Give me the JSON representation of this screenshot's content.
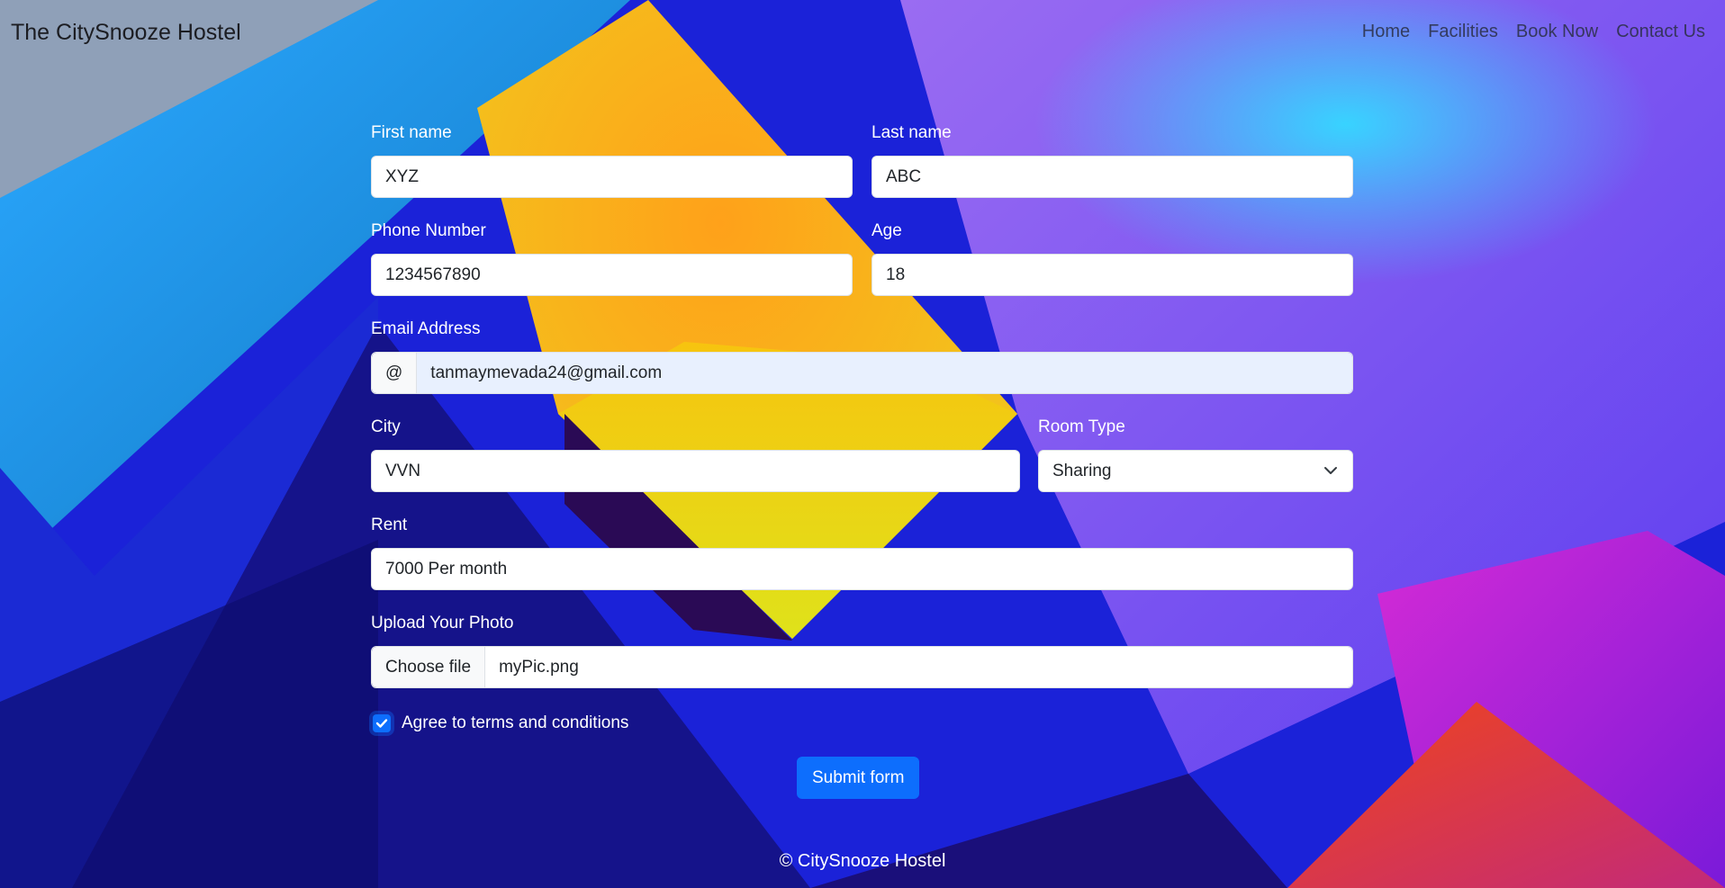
{
  "navbar": {
    "brand": "The CitySnooze Hostel",
    "links": [
      "Home",
      "Facilities",
      "Book Now",
      "Contact Us"
    ]
  },
  "form": {
    "first_name": {
      "label": "First name",
      "value": "XYZ"
    },
    "last_name": {
      "label": "Last name",
      "value": "ABC"
    },
    "phone": {
      "label": "Phone Number",
      "value": "1234567890"
    },
    "age": {
      "label": "Age",
      "value": "18"
    },
    "email": {
      "label": "Email Address",
      "addon": "@",
      "value": "tanmaymevada24@gmail.com"
    },
    "city": {
      "label": "City",
      "value": "VVN"
    },
    "room_type": {
      "label": "Room Type",
      "value": "Sharing"
    },
    "rent": {
      "label": "Rent",
      "value": "7000 Per month"
    },
    "photo": {
      "label": "Upload Your Photo",
      "button": "Choose file",
      "value": "myPic.png"
    },
    "terms": {
      "label": "Agree to terms and conditions",
      "checked": true
    },
    "submit_label": "Submit form"
  },
  "footer": {
    "text": "© CitySnooze Hostel"
  },
  "colors": {
    "accent": "#0d6efd",
    "label_text": "#ffffff",
    "autofill_bg": "#e8f0fe"
  }
}
